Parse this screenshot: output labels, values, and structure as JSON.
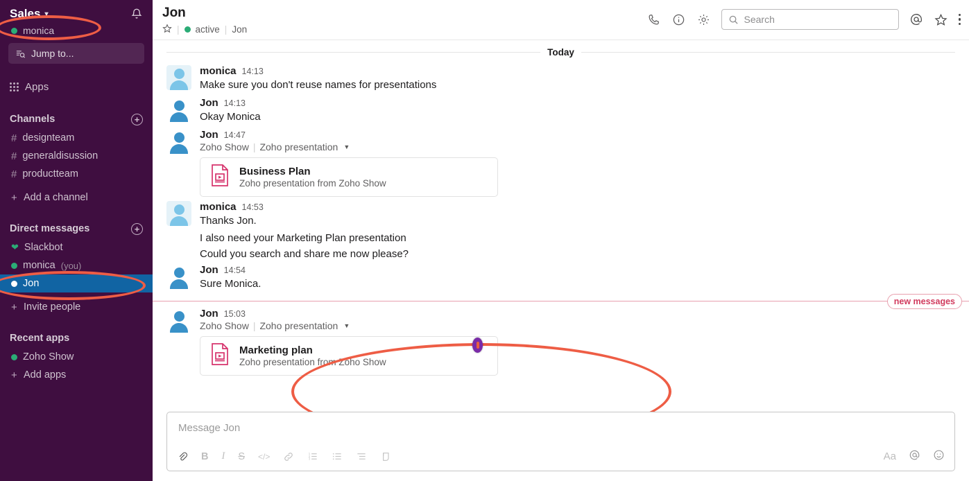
{
  "sidebar": {
    "workspace": "Sales",
    "workspace_caret": "chevron-down-icon",
    "current_user": "monica",
    "jump_to": "Jump to...",
    "apps_label": "Apps",
    "channels": {
      "title": "Channels",
      "items": [
        {
          "label": "designteam"
        },
        {
          "label": "generaldisussion"
        },
        {
          "label": "productteam"
        }
      ],
      "add": "Add a channel"
    },
    "dms": {
      "title": "Direct messages",
      "items": [
        {
          "label": "Slackbot",
          "icon": "heart-icon"
        },
        {
          "label": "monica",
          "suffix": "(you)",
          "icon": "presence-active"
        },
        {
          "label": "Jon",
          "icon": "presence-away",
          "selected": true
        }
      ],
      "invite": "Invite people"
    },
    "recent_apps": {
      "title": "Recent apps",
      "items": [
        {
          "label": "Zoho Show"
        }
      ],
      "add": "Add apps"
    }
  },
  "header": {
    "title": "Jon",
    "status": "active",
    "member": "Jon",
    "star_icon": "star-outline-icon",
    "sep": "|"
  },
  "topbar": {
    "call_icon": "phone-icon",
    "info_icon": "info-circle-icon",
    "settings_icon": "gear-icon",
    "search_placeholder": "Search",
    "mentions_icon": "at-icon",
    "starred_icon": "star-outline-icon",
    "more_icon": "kebab-menu-icon"
  },
  "conversation": {
    "day_divider": "Today",
    "new_messages_label": "new messages",
    "messages": [
      {
        "author": "monica",
        "time": "14:13",
        "text": "Make sure you don't reuse names for presentations",
        "avatar": "mon"
      },
      {
        "author": "Jon",
        "time": "14:13",
        "text": "Okay Monica",
        "avatar": "jon"
      },
      {
        "author": "Jon",
        "time": "14:47",
        "app_name": "Zoho Show",
        "app_type": "Zoho presentation",
        "avatar": "jon",
        "file": {
          "title": "Business Plan",
          "subtitle": "Zoho presentation from Zoho Show",
          "icon": "presentation-file-icon"
        }
      },
      {
        "author": "monica",
        "time": "14:53",
        "text": "Thanks Jon.",
        "avatar": "mon",
        "extra_lines": [
          "I also need your Marketing Plan presentation",
          "Could you search and share me now please?"
        ]
      },
      {
        "author": "Jon",
        "time": "14:54",
        "text": "Sure Monica.",
        "avatar": "jon"
      },
      {
        "author": "Jon",
        "time": "15:03",
        "app_name": "Zoho Show",
        "app_type": "Zoho presentation",
        "avatar": "jon",
        "file": {
          "title": "Marketing plan",
          "subtitle": "Zoho presentation from Zoho Show",
          "icon": "presentation-file-icon"
        }
      }
    ]
  },
  "composer": {
    "placeholder": "Message Jon",
    "tools_left": [
      {
        "name": "attach-icon",
        "glyph": "✉"
      },
      {
        "name": "bold-icon",
        "glyph": "B"
      },
      {
        "name": "italic-icon",
        "glyph": "I"
      },
      {
        "name": "strikethrough-icon",
        "glyph": "S"
      },
      {
        "name": "code-icon",
        "glyph": "</>"
      },
      {
        "name": "link-icon",
        "glyph": "🔗"
      },
      {
        "name": "ordered-list-icon",
        "glyph": "≡"
      },
      {
        "name": "bulleted-list-icon",
        "glyph": "☰"
      },
      {
        "name": "blockquote-icon",
        "glyph": "≡"
      },
      {
        "name": "code-block-icon",
        "glyph": "⎙"
      }
    ],
    "tools_right": [
      {
        "name": "formatting-toggle",
        "glyph": "Aa"
      },
      {
        "name": "mention-icon",
        "glyph": "@"
      },
      {
        "name": "emoji-icon",
        "glyph": "☺"
      }
    ]
  },
  "colors": {
    "sidebar_bg": "#3F0E40",
    "selected_bg": "#1164A3",
    "presence_green": "#2BAC76",
    "annotation_red": "#EE5D45",
    "file_icon_pink": "#D6336C",
    "new_messages": "#D13B5E"
  }
}
